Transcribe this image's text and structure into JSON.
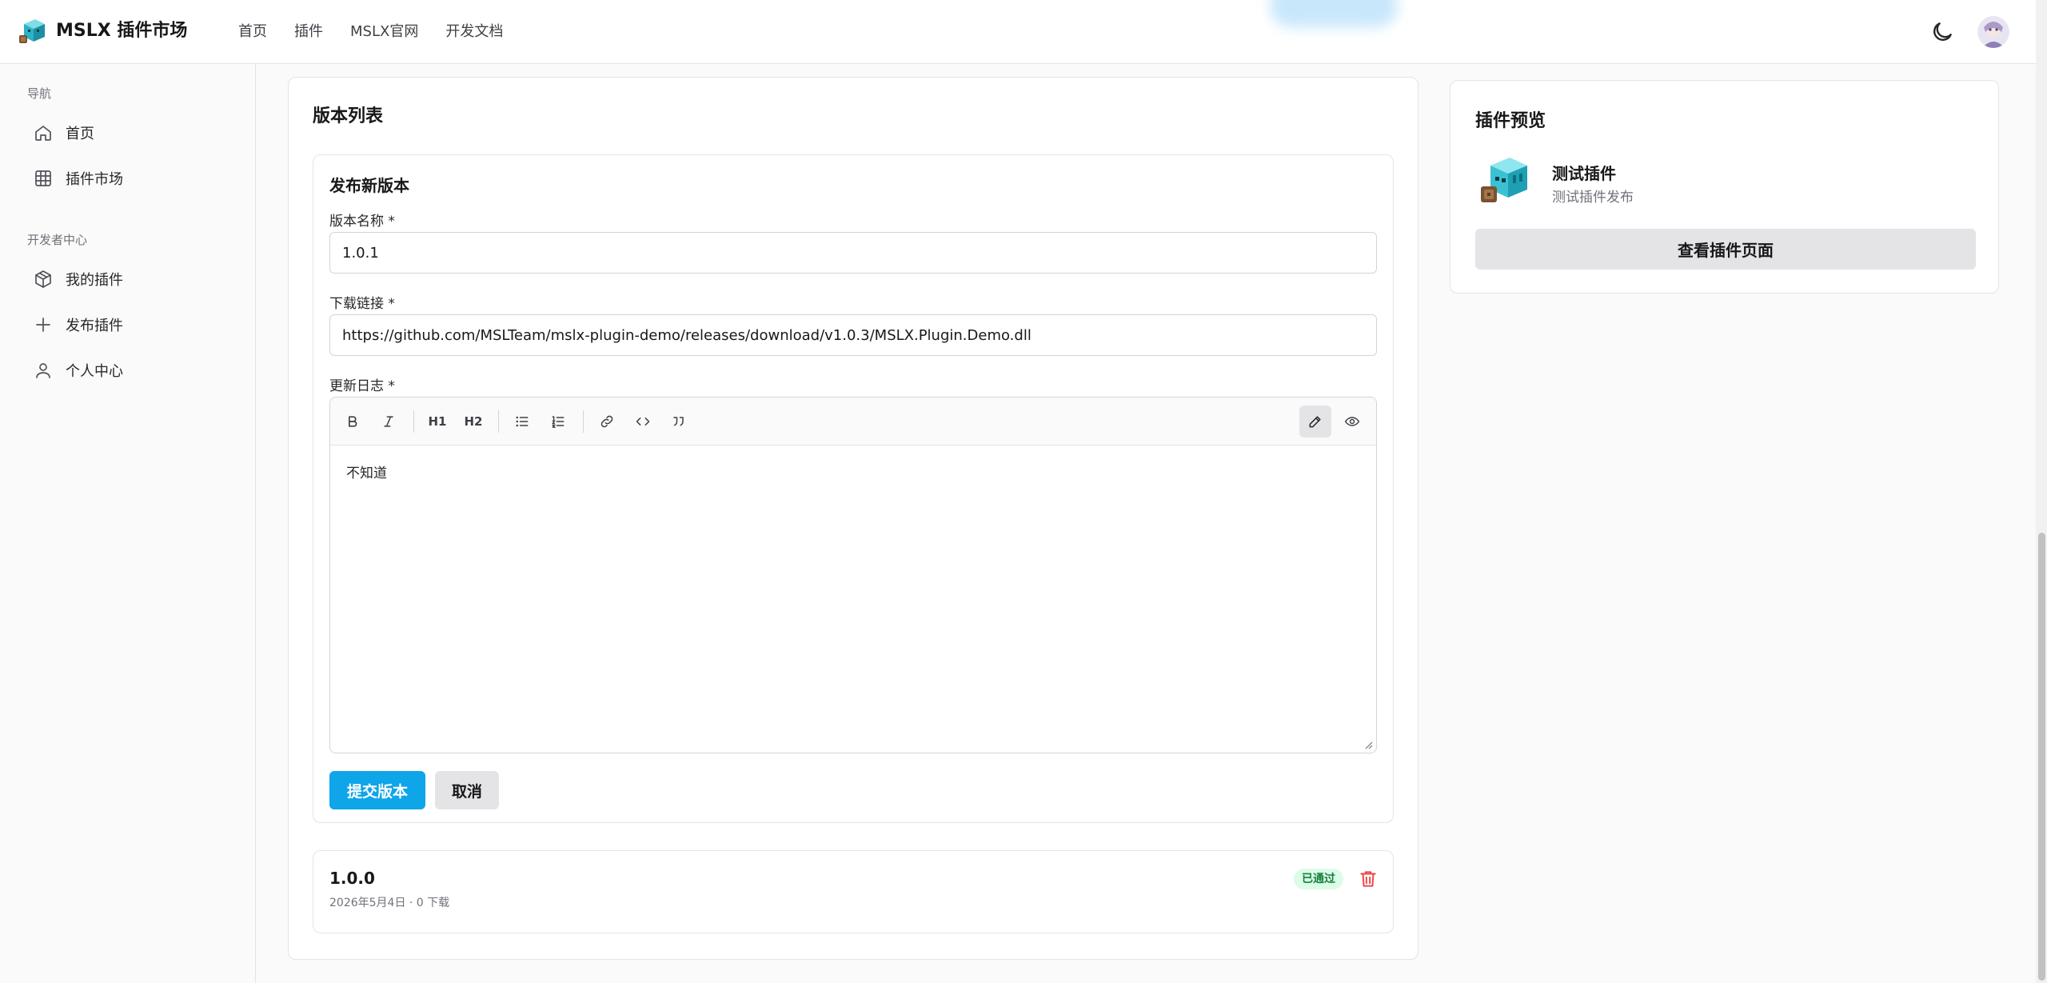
{
  "header": {
    "brand": "MSLX 插件市场",
    "nav": [
      "首页",
      "插件",
      "MSLX官网",
      "开发文档"
    ],
    "theme_icon": "moon-icon",
    "avatar_icon": "avatar"
  },
  "sidebar": {
    "section_nav": "导航",
    "section_dev": "开发者中心",
    "items": [
      {
        "label": "首页",
        "icon": "home-icon"
      },
      {
        "label": "插件市场",
        "icon": "grid-icon"
      },
      {
        "label": "我的插件",
        "icon": "package-icon"
      },
      {
        "label": "发布插件",
        "icon": "plus-icon"
      },
      {
        "label": "个人中心",
        "icon": "user-icon"
      }
    ]
  },
  "main": {
    "title": "版本列表",
    "form": {
      "title": "发布新版本",
      "version_label": "版本名称 *",
      "version_value": "1.0.1",
      "link_label": "下载链接 *",
      "link_value": "https://github.com/MSLTeam/mslx-plugin-demo/releases/download/v1.0.3/MSLX.Plugin.Demo.dll",
      "changelog_label": "更新日志 *",
      "changelog_value": "不知道",
      "toolbar": {
        "h1": "H1",
        "h2": "H2"
      },
      "submit": "提交版本",
      "cancel": "取消"
    },
    "versions": [
      {
        "name": "1.0.0",
        "meta": "2026年5月4日 · 0 下载",
        "status": "已通过"
      }
    ]
  },
  "preview": {
    "title": "插件预览",
    "plugin_name": "测试插件",
    "plugin_desc": "测试插件发布",
    "view_button": "查看插件页面"
  },
  "colors": {
    "accent": "#0ea5e9",
    "success_bg": "#dcfce7",
    "success_text": "#15803d",
    "danger": "#ef4444"
  }
}
